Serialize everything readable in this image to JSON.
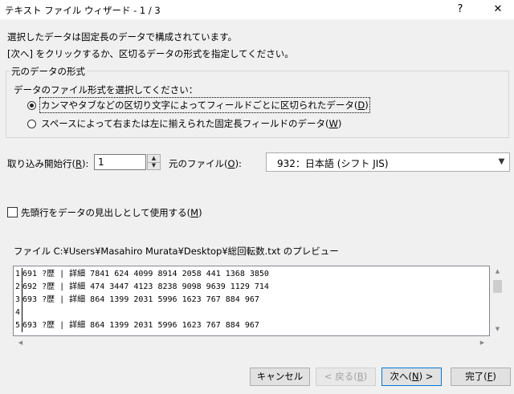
{
  "window": {
    "title": "テキスト ファイル ウィザード - 1 / 3",
    "help_label": "?",
    "close_label": "✕"
  },
  "intro": {
    "line1": "選択したデータは固定長のデータで構成されています。",
    "line2": "[次へ] をクリックするか、区切るデータの形式を指定してください。"
  },
  "source_format": {
    "group_label": "元のデータの形式",
    "prompt": "データのファイル形式を選択してください：",
    "option_delimited": {
      "text": "カンマやタブなどの区切り文字によってフィールドごとに区切られたデータ(",
      "mnemonic": "D",
      "close": ")",
      "selected": true
    },
    "option_fixed": {
      "text": "スペースによって右または左に揃えられた固定長フィールドのデータ(",
      "mnemonic": "W",
      "close": ")",
      "selected": false
    }
  },
  "start_row": {
    "label_text": "取り込み開始行(",
    "mnemonic": "R",
    "label_close": "):",
    "value": "1"
  },
  "file_origin": {
    "label_text": "元のファイル(",
    "mnemonic": "O",
    "label_close": "):",
    "value": "932：日本語 (シフト JIS)"
  },
  "header_checkbox": {
    "text": "先頭行をデータの見出しとして使用する(",
    "mnemonic": "M",
    "close": ")",
    "checked": false
  },
  "preview": {
    "label": "ファイル C:¥Users¥Masahiro Murata¥Desktop¥総回転数.txt のプレビュー",
    "rows": [
      {
        "num": "1",
        "text": "691 ?歴 | 詳細 7841 624 4099 8914 2058 441 1368 3850"
      },
      {
        "num": "2",
        "text": "692 ?歴 | 詳細 474 3447 4123 8238 9098 9639 1129 714"
      },
      {
        "num": "3",
        "text": "693 ?歴 | 詳細 864 1399 2031 5996 1623 767 884 967"
      },
      {
        "num": "4",
        "text": ""
      },
      {
        "num": "5",
        "text": "693 ?歴 | 詳細 864 1399 2031 5996 1623 767 884 967"
      }
    ]
  },
  "buttons": {
    "cancel": "キャンセル",
    "back": {
      "text": "< 戻る(",
      "mnemonic": "B",
      "close": ")"
    },
    "next": {
      "text": "次へ(",
      "mnemonic": "N",
      "close": ") >"
    },
    "finish": {
      "text": "完了(",
      "mnemonic": "F",
      "close": ")"
    }
  },
  "icons": {
    "spin_up": "spin-up-icon",
    "spin_down": "spin-down-icon",
    "combo_arrow": "chevron-down-icon",
    "scroll_up": "scroll-up-icon",
    "scroll_down": "scroll-down-icon",
    "scroll_left": "scroll-left-icon",
    "scroll_right": "scroll-right-icon"
  }
}
